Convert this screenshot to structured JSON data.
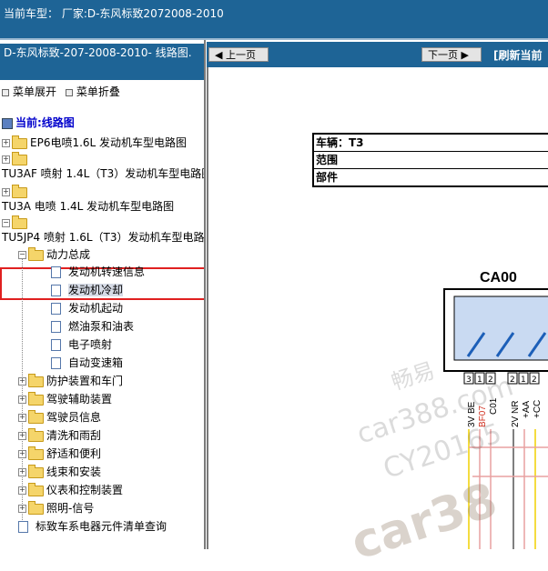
{
  "top_bar": {
    "vehicle_line": "当前车型：  厂家:D-东风标致2072008-2010"
  },
  "left_panel": {
    "title": "D-东风标致-207-2008-2010- 线路图.",
    "expand_all": "菜单展开",
    "collapse_all": "菜单折叠",
    "current_label": "当前:线路图",
    "tree": [
      {
        "label": "EP6电喷1.6L 发动机车型电路图"
      },
      {
        "label": "TU3AF 喷射 1.4L（T3）发动机车型电路图"
      },
      {
        "label": "TU3A 电喷 1.4L 发动机车型电路图"
      },
      {
        "label": "TU5JP4 喷射 1.6L（T3）发动机车型电路图"
      }
    ],
    "powertrain": {
      "label": "动力总成",
      "items": [
        "发动机转速信息",
        "发动机冷却",
        "发动机起动",
        "燃油泵和油表",
        "电子喷射",
        "自动变速箱"
      ]
    },
    "subfolders": [
      "防护装置和车门",
      "驾驶辅助装置",
      "驾驶员信息",
      "清洗和雨刮",
      "舒适和便利",
      "线束和安装",
      "仪表和控制装置",
      "照明-信号"
    ],
    "query": "标致车系电器元件清单查询"
  },
  "right_panel": {
    "prev_label": "上一页",
    "next_label": "下一页",
    "refresh_label": "[刷新当前",
    "info": {
      "vehicle": "车辆：T3",
      "range": "范围",
      "part": "部件"
    },
    "connector": {
      "name": "CA00",
      "pins": [
        "3",
        "1",
        "2",
        "2",
        "1",
        "2"
      ],
      "wires": [
        "3V BE",
        "BF07",
        "C01",
        "2V NR",
        "+AA",
        "+CC"
      ]
    }
  },
  "watermarks": [
    "畅易",
    "car388.com",
    "CY20165",
    "car38"
  ]
}
